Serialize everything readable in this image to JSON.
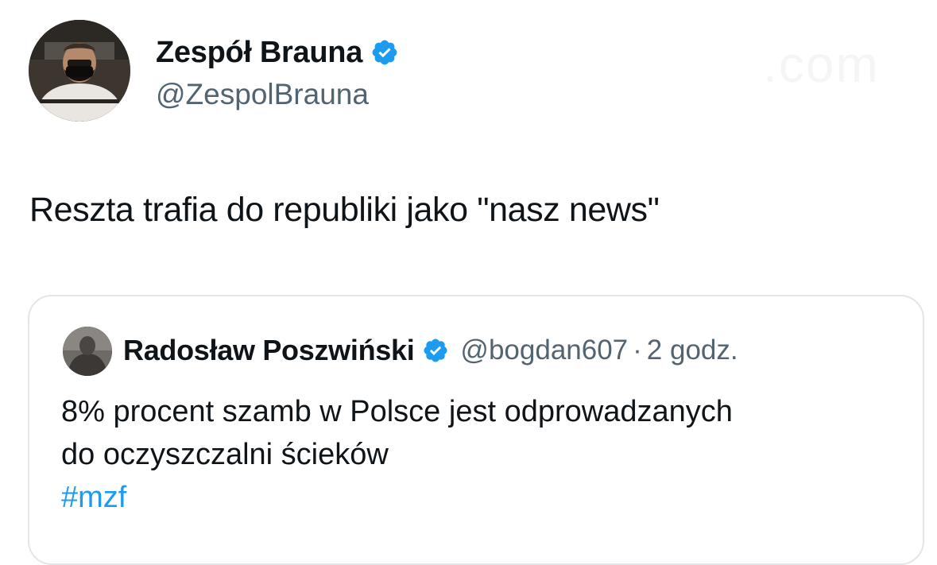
{
  "tweet": {
    "author": {
      "display_name": "Zespół Brauna",
      "handle": "@ZespolBrauna",
      "verified": true
    },
    "text": "Reszta trafia do republiki jako \"nasz news\"",
    "watermark": ".com"
  },
  "quote": {
    "author": {
      "display_name": "Radosław Poszwiński",
      "handle": "@bogdan607",
      "verified": true
    },
    "separator": "·",
    "time": "2 godz.",
    "lines": [
      "8% procent szamb w Polsce jest odprowadzanych",
      "do oczyszczalni ścieków"
    ],
    "hashtag": "#mzf"
  },
  "colors": {
    "text": "#0f1419",
    "secondary": "#536471",
    "accent": "#1d9bf0",
    "border": "#e3e6e9"
  },
  "icons": {
    "verified": "verified-badge-icon"
  }
}
